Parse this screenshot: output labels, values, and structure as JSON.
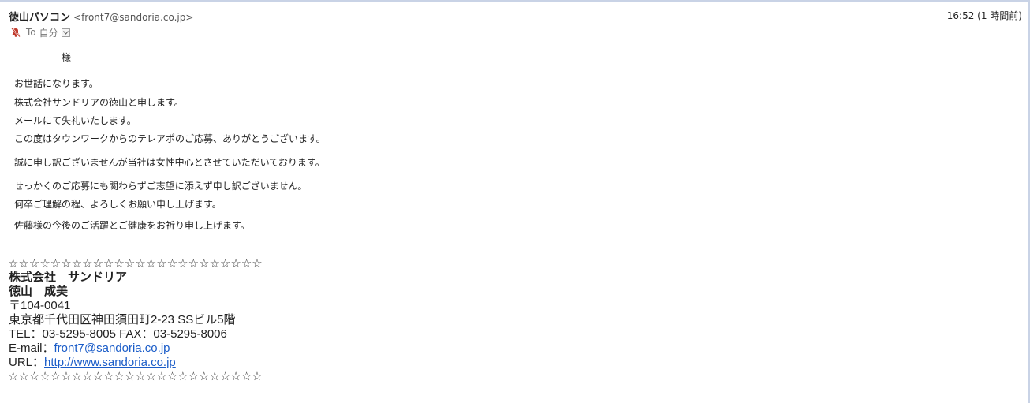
{
  "header": {
    "sender_name": "徳山パソコン",
    "sender_email": "<front7@sandoria.co.jp>",
    "timestamp": "16:52 (1 時間前)",
    "to_label": "To",
    "recipient": "自分",
    "muted_icon": "muted-bell-icon",
    "dropdown_icon": "chevron-down-icon"
  },
  "body": {
    "salutation": "様",
    "lines": [
      "お世話になります。",
      "株式会社サンドリアの徳山と申します。",
      "メールにて失礼いたします。",
      "この度はタウンワークからのテレアポのご応募、ありがとうございます。",
      "誠に申し訳ございませんが当社は女性中心とさせていただいております。",
      "せっかくのご応募にも関わらずご志望に添えず申し訳ございません。",
      "何卒ご理解の程、よろしくお願い申し上げます。",
      "佐藤様の今後のご活躍とご健康をお祈り申し上げます。"
    ]
  },
  "signature": {
    "stars_top": "☆☆☆☆☆☆☆☆☆☆☆☆☆☆☆☆☆☆☆☆☆☆☆☆",
    "company": "株式会社　サンドリア",
    "person": "徳山　成美",
    "postal": "〒104-0041",
    "address": "東京都千代田区神田須田町2-23 SSビル5階",
    "phone": "TEL：03-5295-8005 FAX：03-5295-8006",
    "email_label": "E-mail：",
    "email_link": "front7@sandoria.co.jp",
    "url_label": "URL：",
    "url_link": "http://www.sandoria.co.jp",
    "stars_bottom": "☆☆☆☆☆☆☆☆☆☆☆☆☆☆☆☆☆☆☆☆☆☆☆☆"
  },
  "colors": {
    "link": "#1a5cc8",
    "muted_icon": "#c0392b"
  }
}
